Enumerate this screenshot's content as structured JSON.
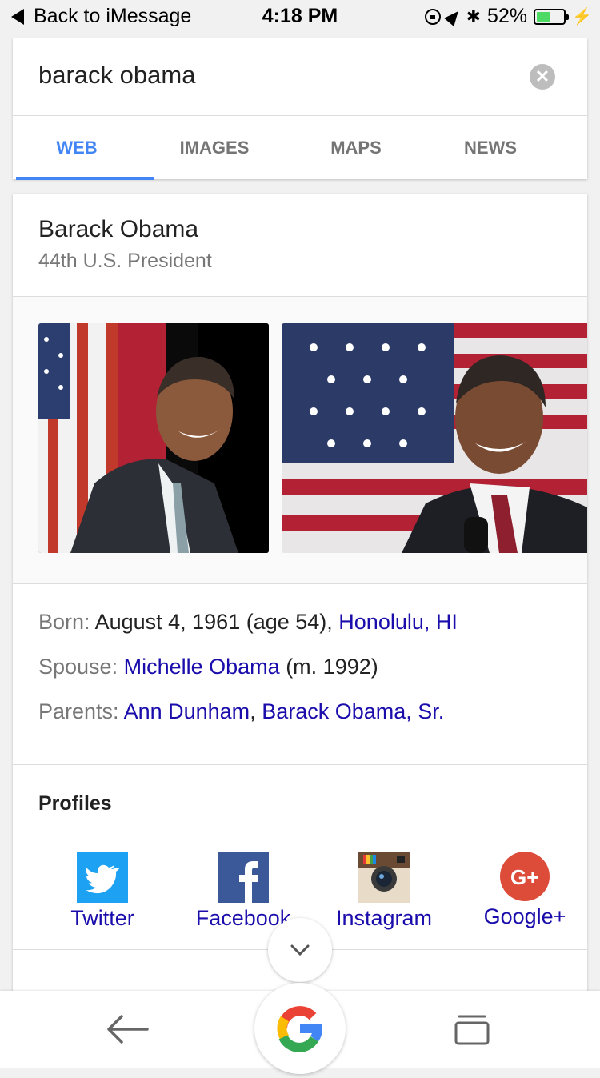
{
  "status_bar": {
    "back_label": "Back to iMessage",
    "time": "4:18 PM",
    "battery_percent": "52%",
    "battery_level": 0.52,
    "icons": [
      "rotation-lock-icon",
      "location-arrow-icon",
      "bluetooth-icon",
      "battery-icon",
      "charging-bolt-icon"
    ]
  },
  "search": {
    "query": "barack obama",
    "tabs": [
      {
        "label": "WEB",
        "active": true
      },
      {
        "label": "IMAGES",
        "active": false
      },
      {
        "label": "MAPS",
        "active": false
      },
      {
        "label": "NEWS",
        "active": false
      }
    ]
  },
  "knowledge_panel": {
    "title": "Barack Obama",
    "subtitle": "44th U.S. President",
    "facts": {
      "born": {
        "key": "Born:",
        "value": "August 4, 1961 (age 54),",
        "link": "Honolulu, HI"
      },
      "spouse": {
        "key": "Spouse:",
        "link": "Michelle Obama",
        "value": "(m. 1992)"
      },
      "parents": {
        "key": "Parents:",
        "link1": "Ann Dunham",
        "sep": ",",
        "link2": "Barack Obama, Sr."
      }
    },
    "profiles_title": "Profiles",
    "profiles": [
      {
        "label": "Twitter",
        "icon": "twitter-icon"
      },
      {
        "label": "Facebook",
        "icon": "facebook-icon"
      },
      {
        "label": "Instagram",
        "icon": "instagram-icon"
      },
      {
        "label": "Google+",
        "icon": "google-plus-icon"
      }
    ]
  },
  "colors": {
    "accent": "#4285f4",
    "link": "#1a0dab",
    "twitter": "#1da1f2",
    "facebook": "#3b5998",
    "google_plus": "#dd4b39",
    "battery_green": "#4cd964"
  }
}
